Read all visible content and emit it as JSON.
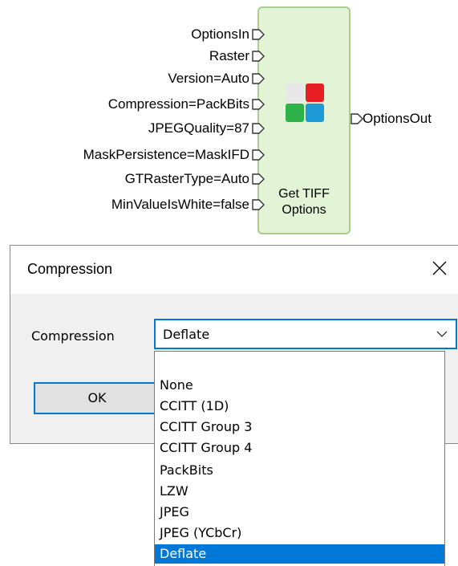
{
  "node": {
    "inputs": [
      "OptionsIn",
      "Raster",
      "Version=Auto",
      "Compression=PackBits",
      "JPEGQuality=87",
      "MaskPersistence=MaskIFD",
      "GTRasterType=Auto",
      "MinValueIsWhite=false"
    ],
    "output": "OptionsOut",
    "title_line1": "Get TIFF",
    "title_line2": "Options",
    "icon_colors": [
      "#e8e8e8",
      "#e81e25",
      "#2db34a",
      "#1e9bd7"
    ],
    "fill_color": "#e3f3d6",
    "border_color": "#a8d08d"
  },
  "dialog": {
    "title": "Compression",
    "close_glyph": "✕",
    "field_label": "Compression",
    "selected_value": "Deflate",
    "ok_label": "OK",
    "accent": "#0078d7"
  },
  "dropdown": {
    "items": [
      "",
      "None",
      "CCITT (1D)",
      "CCITT Group 3",
      "CCITT Group 4",
      "PackBits",
      "LZW",
      "JPEG",
      "JPEG (YCbCr)",
      "Deflate"
    ],
    "selected_index": 9
  }
}
